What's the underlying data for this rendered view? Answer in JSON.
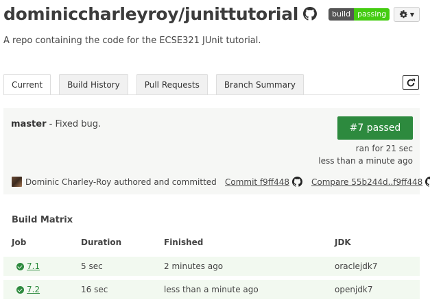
{
  "repo": {
    "title": "dominiccharleyroy/junittutorial",
    "description": "A repo containing the code for the ECSE321 JUnit tutorial."
  },
  "badge": {
    "left": "build",
    "right": "passing"
  },
  "tabs": [
    {
      "label": "Current",
      "active": true
    },
    {
      "label": "Build History",
      "active": false
    },
    {
      "label": "Pull Requests",
      "active": false
    },
    {
      "label": "Branch Summary",
      "active": false
    }
  ],
  "build": {
    "branch": "master",
    "message": "- Fixed bug.",
    "status_label": "#7 passed",
    "ran_for": "ran for 21 sec",
    "finished": "less than a minute ago",
    "author_text": "Dominic Charley-Roy authored and committed",
    "commit_link": "Commit f9ff448",
    "compare_link": "Compare 55b244d..f9ff448"
  },
  "matrix": {
    "title": "Build Matrix",
    "headers": {
      "job": "Job",
      "duration": "Duration",
      "finished": "Finished",
      "jdk": "JDK"
    },
    "rows": [
      {
        "job": "7.1",
        "duration": "5 sec",
        "finished": "2 minutes ago",
        "jdk": "oraclejdk7"
      },
      {
        "job": "7.2",
        "duration": "16 sec",
        "finished": "less than a minute ago",
        "jdk": "openjdk7"
      }
    ]
  },
  "colors": {
    "passed_green": "#2d8a3e",
    "badge_green": "#44cc11",
    "panel_bg": "#f6f7f5"
  },
  "icons": {
    "github": "github-octocat-icon",
    "gear": "gear-icon",
    "refresh": "refresh-icon",
    "check": "check-circle-icon"
  }
}
